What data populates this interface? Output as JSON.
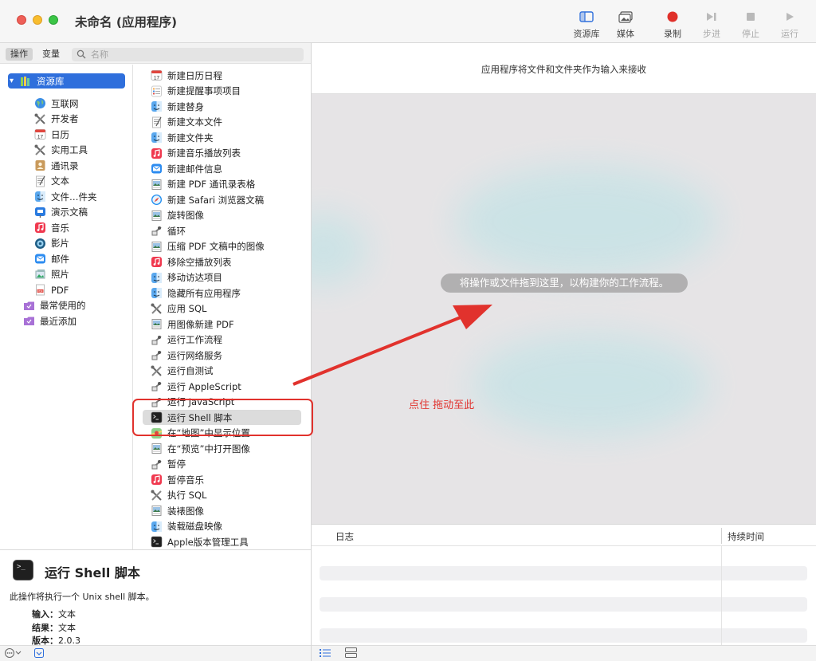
{
  "window": {
    "title": "未命名 (应用程序)"
  },
  "toolbar": {
    "library": "资源库",
    "media": "媒体",
    "record": "录制",
    "step": "步进",
    "stop": "停止",
    "run": "运行",
    "record_color": "#e0302a"
  },
  "left_tabs": {
    "actions": "操作",
    "variables": "变量"
  },
  "search": {
    "placeholder": "名称",
    "value": ""
  },
  "library": {
    "root": "资源库",
    "items": [
      {
        "label": "互联网",
        "icon": "globe-icon"
      },
      {
        "label": "开发者",
        "icon": "tools-icon"
      },
      {
        "label": "日历",
        "icon": "calendar-icon"
      },
      {
        "label": "实用工具",
        "icon": "tools-icon"
      },
      {
        "label": "通讯录",
        "icon": "contacts-icon"
      },
      {
        "label": "文本",
        "icon": "text-icon"
      },
      {
        "label": "文件…件夹",
        "icon": "finder-icon"
      },
      {
        "label": "演示文稿",
        "icon": "keynote-icon"
      },
      {
        "label": "音乐",
        "icon": "music-icon"
      },
      {
        "label": "影片",
        "icon": "movie-icon"
      },
      {
        "label": "邮件",
        "icon": "mail-icon"
      },
      {
        "label": "照片",
        "icon": "photo-icon"
      },
      {
        "label": "PDF",
        "icon": "pdf-icon"
      }
    ],
    "smart": [
      {
        "label": "最常使用的",
        "icon": "smart-folder-icon"
      },
      {
        "label": "最近添加",
        "icon": "smart-folder-icon"
      }
    ]
  },
  "actions": [
    {
      "label": "新建日历日程",
      "icon": "calendar-icon"
    },
    {
      "label": "新建提醒事项项目",
      "icon": "reminders-icon"
    },
    {
      "label": "新建替身",
      "icon": "finder-icon"
    },
    {
      "label": "新建文本文件",
      "icon": "text-icon"
    },
    {
      "label": "新建文件夹",
      "icon": "finder-icon"
    },
    {
      "label": "新建音乐播放列表",
      "icon": "music-icon"
    },
    {
      "label": "新建邮件信息",
      "icon": "mail-icon"
    },
    {
      "label": "新建 PDF 通讯录表格",
      "icon": "preview-icon"
    },
    {
      "label": "新建 Safari 浏览器文稿",
      "icon": "safari-icon"
    },
    {
      "label": "旋转图像",
      "icon": "preview-icon"
    },
    {
      "label": "循环",
      "icon": "automator-icon"
    },
    {
      "label": "压缩 PDF 文稿中的图像",
      "icon": "preview-icon"
    },
    {
      "label": "移除空播放列表",
      "icon": "music-icon"
    },
    {
      "label": "移动访达项目",
      "icon": "finder-icon"
    },
    {
      "label": "隐藏所有应用程序",
      "icon": "finder-icon"
    },
    {
      "label": "应用 SQL",
      "icon": "tools-icon"
    },
    {
      "label": "用图像新建 PDF",
      "icon": "preview-icon"
    },
    {
      "label": "运行工作流程",
      "icon": "automator-icon"
    },
    {
      "label": "运行网络服务",
      "icon": "automator-icon"
    },
    {
      "label": "运行自测试",
      "icon": "tools-icon"
    },
    {
      "label": "运行 AppleScript",
      "icon": "automator-icon"
    },
    {
      "label": "运行 JavaScript",
      "icon": "automator-icon"
    },
    {
      "label": "运行 Shell 脚本",
      "icon": "terminal-icon"
    },
    {
      "label": "在“地图”中显示位置",
      "icon": "maps-icon"
    },
    {
      "label": "在“预览”中打开图像",
      "icon": "preview-icon"
    },
    {
      "label": "暂停",
      "icon": "automator-icon"
    },
    {
      "label": "暂停音乐",
      "icon": "music-icon"
    },
    {
      "label": "执行 SQL",
      "icon": "tools-icon"
    },
    {
      "label": "装裱图像",
      "icon": "preview-icon"
    },
    {
      "label": "装载磁盘映像",
      "icon": "finder-icon"
    },
    {
      "label": "Apple版本管理工具",
      "icon": "terminal-icon"
    }
  ],
  "selected_action": "运行 Shell 脚本",
  "description": {
    "title": "运行 Shell 脚本",
    "text": "此操作将执行一个 Unix shell 脚本。",
    "input_label": "输入：",
    "input_value": "文本",
    "result_label": "结果：",
    "result_value": "文本",
    "version_label": "版本：",
    "version_value": "2.0.3"
  },
  "workflow": {
    "header": "应用程序将文件和文件夹作为输入来接收",
    "drop_hint": "将操作或文件拖到这里，以构建你的工作流程。",
    "annotation": "点住 拖动至此",
    "annotation_color": "#e1322d"
  },
  "log": {
    "col_log": "日志",
    "col_duration": "持续时间"
  }
}
